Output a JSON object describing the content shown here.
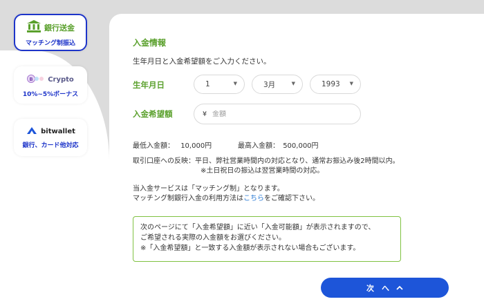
{
  "sidebar": {
    "bank": {
      "title": "銀行送金",
      "sub": "マッチング制振込"
    },
    "crypto": {
      "title": "Crypto",
      "sub": "10%~5%ボーナス"
    },
    "bitwallet": {
      "title": "bitwallet",
      "sub": "銀行、カード他対応"
    }
  },
  "form": {
    "section_title": "入金情報",
    "instruction": "生年月日と入金希望額をご入力ください。",
    "birthdate_label": "生年月日",
    "day": "1",
    "month": "3月",
    "year": "1993",
    "amount_label": "入金希望額",
    "currency": "¥",
    "amount_placeholder": "金額",
    "min_label": "最低入金額：",
    "min_value": "10,000円",
    "max_label": "最高入金額：",
    "max_value": "500,000円",
    "reflect_line1": "取引口座への反映：平日、弊社営業時間内の対応となり、通常お振込み後2時間以内。",
    "reflect_line2": "※土日祝日の振込は翌営業時間の対応。",
    "service_line1": "当入金サービスは「マッチング制」となります。",
    "service_line2_pre": "マッチング制銀行入金の利用方法は",
    "service_link": "こちら",
    "service_line2_post": "をご確認下さい。",
    "notice_line1": "次のページにて「入金希望額」に近い「入金可能額」が表示されますので、",
    "notice_line2": "ご希望される実際の入金額をお選びください。",
    "notice_line3": "※「入金希望額」と一致する入金額が表示されない場合もございます。",
    "next_label": "次　へ"
  },
  "colors": {
    "accent_green": "#5aa02c",
    "brand_blue": "#1d55d9",
    "border_green": "#7fc241"
  }
}
